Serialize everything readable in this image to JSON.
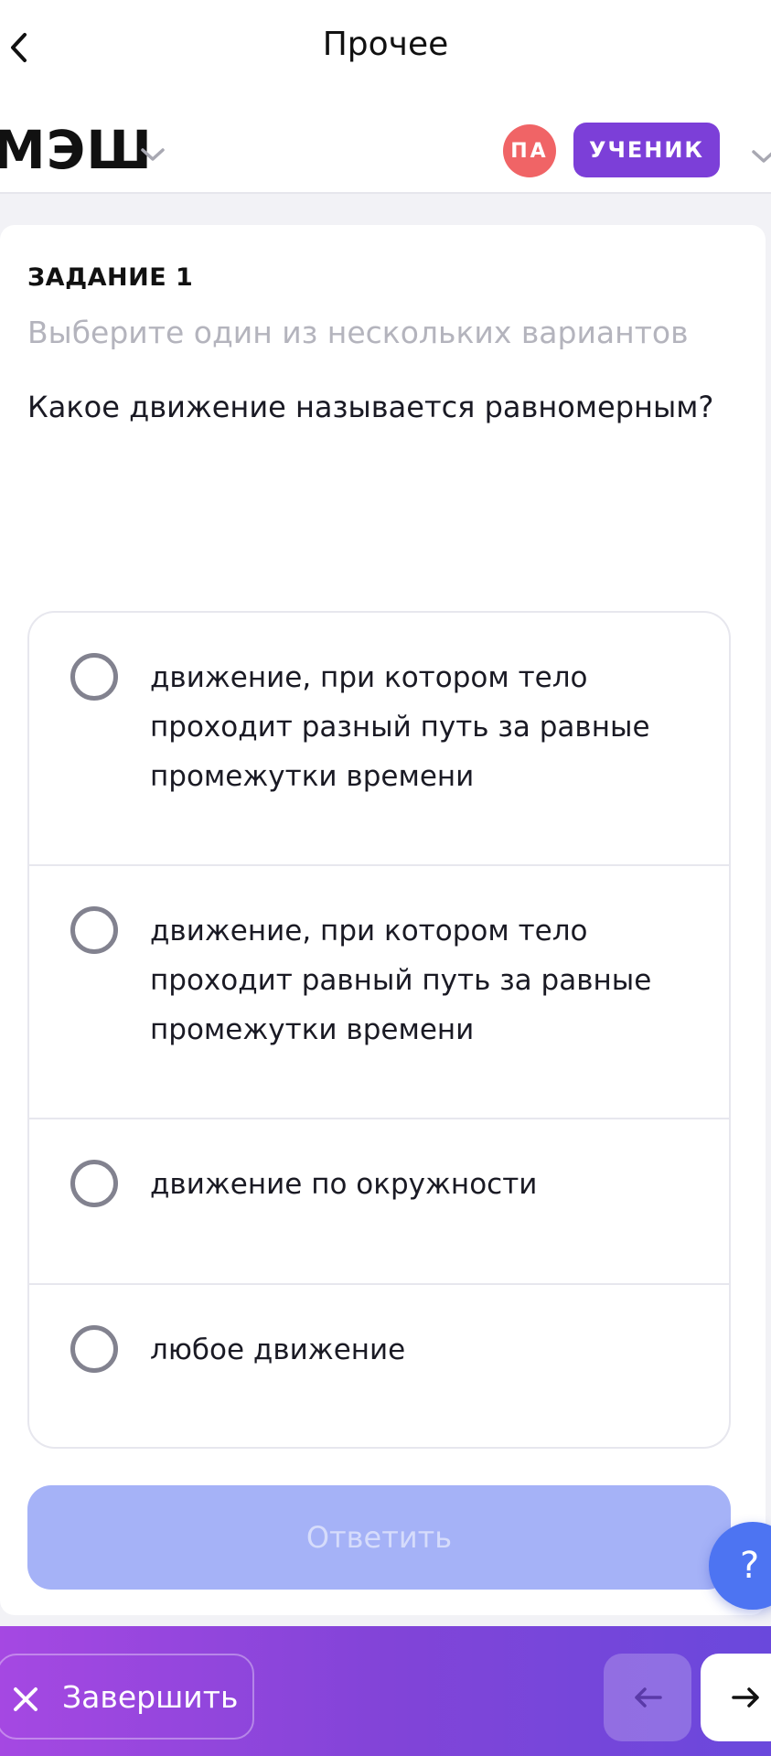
{
  "topbar": {
    "title": "Прочее"
  },
  "header": {
    "logo": "МЭШ",
    "avatar_initials": "ПА",
    "role": "УЧЕНИК"
  },
  "task": {
    "label": "ЗАДАНИЕ 1",
    "hint": "Выберите один из нескольких вариантов",
    "question": "Какое движение называется равномерным?",
    "options": [
      {
        "text": "движение, при котором тело проходит разный путь за равные промежутки времени",
        "selected": false
      },
      {
        "text": "движение, при котором тело проходит равный путь за равные промежутки времени",
        "selected": false
      },
      {
        "text": "движение по окружности",
        "selected": false
      },
      {
        "text": "любое движение",
        "selected": false
      }
    ],
    "answer_label": "Ответить"
  },
  "help": {
    "label": "?"
  },
  "bottombar": {
    "finish_label": "Завершить"
  },
  "colors": {
    "accent": "#7c3fd8",
    "avatar": "#f06466",
    "answer_button": "#a5b2f7",
    "help_button": "#4d74f2",
    "bottom_gradient_start": "#a548e2",
    "bottom_gradient_end": "#6a48dc"
  },
  "icons": {
    "back": "chevron-left-icon",
    "logo_menu": "chevron-down-icon",
    "role_menu": "chevron-down-icon",
    "finish": "close-icon",
    "prev": "arrow-left-icon",
    "next": "arrow-right-icon"
  }
}
